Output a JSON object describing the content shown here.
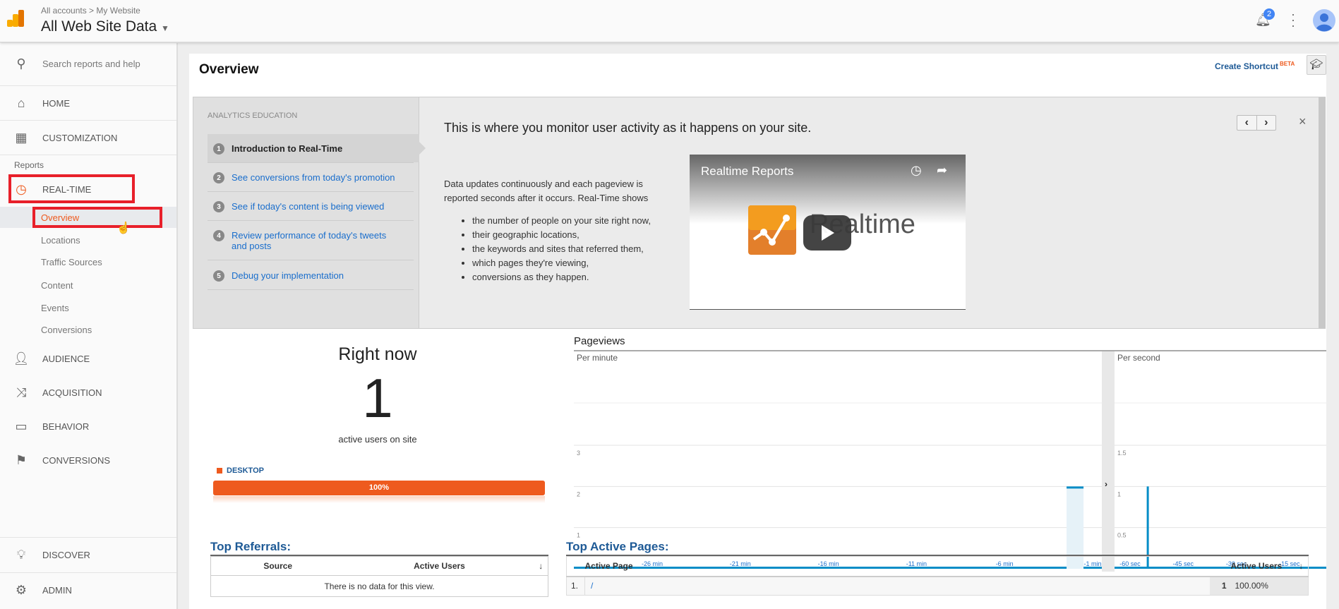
{
  "header": {
    "breadcrumb": [
      "All accounts",
      "My Website"
    ],
    "property": "All Web Site Data",
    "notifications": "2",
    "icons": [
      "analytics-logo",
      "bell-icon",
      "more-vert-icon",
      "avatar"
    ]
  },
  "sidebar": {
    "search_placeholder": "Search reports and help",
    "home": "HOME",
    "customization": "CUSTOMIZATION",
    "reports_label": "Reports",
    "realtime": "REAL-TIME",
    "realtime_items": [
      "Overview",
      "Locations",
      "Traffic Sources",
      "Content",
      "Events",
      "Conversions"
    ],
    "audience": "AUDIENCE",
    "acquisition": "ACQUISITION",
    "behavior": "BEHAVIOR",
    "conversions": "CONVERSIONS",
    "discover": "DISCOVER",
    "admin": "ADMIN"
  },
  "page": {
    "title": "Overview",
    "create_shortcut": "Create Shortcut",
    "beta": "BETA"
  },
  "education": {
    "label": "ANALYTICS EDUCATION",
    "steps": [
      {
        "n": "1",
        "label": "Introduction to Real-Time"
      },
      {
        "n": "2",
        "label": "See conversions from today's promotion"
      },
      {
        "n": "3",
        "label": "See if today's content is being viewed"
      },
      {
        "n": "4",
        "label": "Review performance of today's tweets and posts"
      },
      {
        "n": "5",
        "label": "Debug your implementation"
      }
    ],
    "heading": "This is where you monitor user activity as it happens on your site.",
    "description": "Data updates continuously and each pageview is reported seconds after it occurs. Real-Time shows",
    "bullets": [
      "the number of people on your site right now,",
      "their geographic locations,",
      "the keywords and sites that referred them,",
      "which pages they're viewing,",
      "conversions as they happen."
    ],
    "video_title": "Realtime Reports",
    "video_logo_text": "Realtime"
  },
  "right_now": {
    "title": "Right now",
    "count": "1",
    "caption": "active users on site",
    "device": "DESKTOP",
    "device_pct": "100%",
    "device_fraction": 1.0,
    "accent": "#ee5a1e"
  },
  "pageviews": {
    "title": "Pageviews",
    "per_minute": "Per minute",
    "per_second": "Per second"
  },
  "chart_data": [
    {
      "type": "bar",
      "title": "Per minute",
      "x_ticks": [
        "-26 min",
        "-21 min",
        "-16 min",
        "-11 min",
        "-6 min",
        "-1 min"
      ],
      "y_ticks": [
        "1",
        "2",
        "3"
      ],
      "ylim": [
        0,
        3
      ],
      "xlim": [
        -30,
        -1
      ],
      "points": [
        {
          "x": -2,
          "y": 2
        }
      ],
      "other_values": 0,
      "color": "#058dc7"
    },
    {
      "type": "bar",
      "title": "Per second",
      "x_ticks": [
        "-60 sec",
        "-45 sec",
        "-30 sec",
        "-15 sec"
      ],
      "y_ticks": [
        "0.5",
        "1",
        "1.5"
      ],
      "ylim": [
        0,
        1.5
      ],
      "xlim": [
        -60,
        0
      ],
      "points": [
        {
          "x": -55,
          "y": 1
        }
      ],
      "other_values": 0,
      "color": "#058dc7"
    }
  ],
  "referrals": {
    "title": "Top Referrals:",
    "columns": [
      "Source",
      "Active Users"
    ],
    "empty": "There is no data for this view."
  },
  "active_pages": {
    "title": "Top Active Pages:",
    "columns": [
      "Active Page",
      "Active Users"
    ],
    "rows": [
      {
        "rank": "1.",
        "page": "/",
        "users": "1",
        "pct": "100.00%"
      }
    ]
  }
}
